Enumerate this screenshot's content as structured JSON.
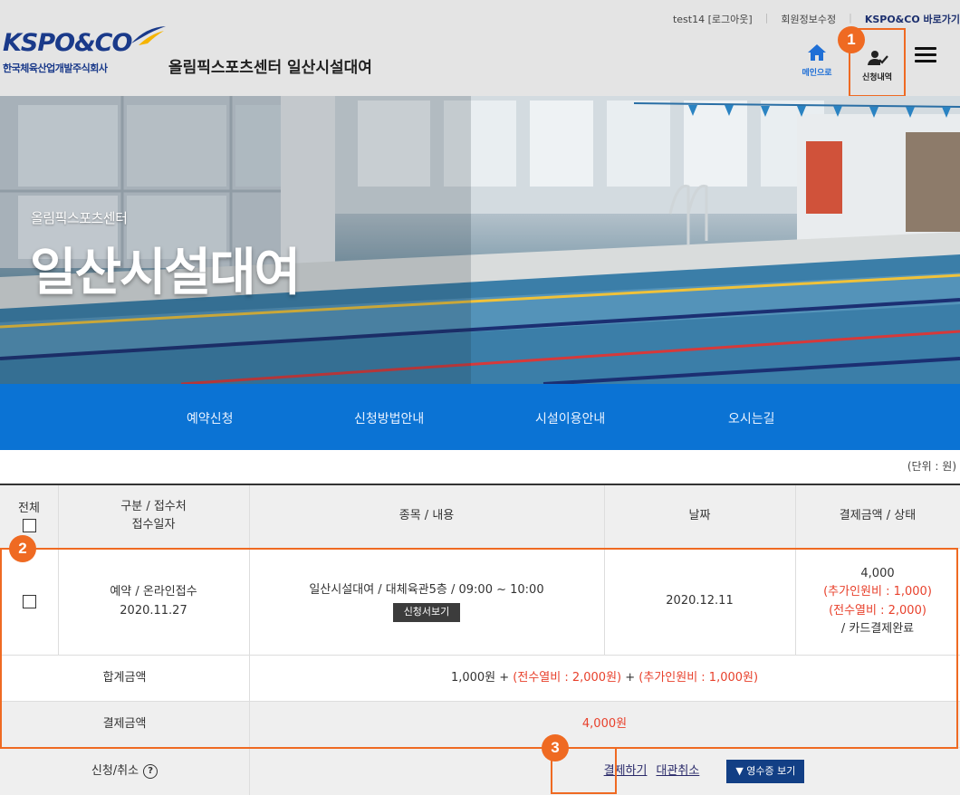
{
  "header": {
    "top_links": [
      "test14 [로그아웃]",
      "회원정보수정",
      "KSPO&CO 바로가기"
    ],
    "logo_brand": "KSPO&CO",
    "logo_sub": "한국체육산업개발주식회사",
    "site_title": "올림픽스포츠센터 일산시설대여",
    "home_label": "메인으로",
    "apply_history_label": "신청내역"
  },
  "badges": [
    "1",
    "2",
    "3"
  ],
  "hero": {
    "subtitle": "올림픽스포츠센터",
    "title": "일산시설대여"
  },
  "nav": {
    "items": [
      "예약신청",
      "신청방법안내",
      "시설이용안내",
      "오시는길"
    ]
  },
  "table": {
    "unit_note": "(단위 : 원)",
    "headers": {
      "all": "전체",
      "type_line1": "구분 / 접수처",
      "type_line2": "접수일자",
      "item": "종목 / 내용",
      "date": "날짜",
      "payment": "결제금액 / 상태"
    },
    "row": {
      "type": "예약 / 온라인접수",
      "received": "2020.11.27",
      "item": "일산시설대여 / 대체육관5층 / 09:00 ~ 10:00",
      "view_button": "신청서보기",
      "date": "2020.12.11",
      "amount": "4,000",
      "extra_person": "(추가인원비 : 1,000)",
      "heating": "(전수열비 : 2,000)",
      "status": "/ 카드결제완료"
    },
    "total": {
      "label": "합계금액",
      "base": "1,000원 + ",
      "heating": "(전수열비 : 2,000원)",
      "plus": " + ",
      "extra": "(추가인원비 : 1,000원)"
    },
    "paid": {
      "label": "결제금액",
      "value": "4,000원"
    },
    "actions": {
      "label": "신청/취소",
      "help_icon": "?",
      "pay": "결제하기",
      "cancel": "대관취소",
      "receipt": "▼ 영수증 보기"
    }
  },
  "colors": {
    "nav_blue": "#0b73d4",
    "highlight_orange": "#ef6a22",
    "accent_red": "#e8412c",
    "receipt_blue": "#123f85"
  }
}
